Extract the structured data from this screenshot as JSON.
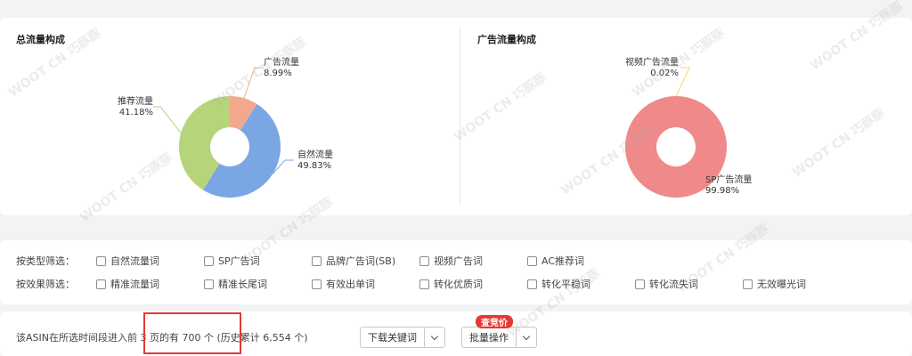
{
  "charts": {
    "total": {
      "title": "总流量构成",
      "chart_data": {
        "type": "pie",
        "title": "总流量构成",
        "donut": true,
        "slices": [
          {
            "name": "广告流量",
            "value": 8.99,
            "label": "8.99%",
            "color": "#f0a98c"
          },
          {
            "name": "自然流量",
            "value": 49.83,
            "label": "49.83%",
            "color": "#7aa7e3"
          },
          {
            "name": "推荐流量",
            "value": 41.18,
            "label": "41.18%",
            "color": "#b6d47a"
          }
        ]
      }
    },
    "ads": {
      "title": "广告流量构成",
      "chart_data": {
        "type": "pie",
        "title": "广告流量构成",
        "donut": true,
        "slices": [
          {
            "name": "视频广告流量",
            "value": 0.02,
            "label": "0.02%",
            "color": "#f5d76e"
          },
          {
            "name": "SP广告流量",
            "value": 99.98,
            "label": "99.98%",
            "color": "#f08a8a"
          }
        ]
      }
    }
  },
  "filters": {
    "type_label": "按类型筛选：",
    "type_options": [
      "自然流量词",
      "SP广告词",
      "品牌广告词(SB)",
      "视频广告词",
      "AC推荐词"
    ],
    "effect_label": "按效果筛选：",
    "effect_options": [
      "精准流量词",
      "精准长尾词",
      "有效出单词",
      "转化优质词",
      "转化平稳词",
      "转化流失词",
      "无效曝光词"
    ]
  },
  "summary": {
    "text": "该ASIN在所选时间段进入前 3 页的有 700 个 (历史累计 6,554 个)",
    "download_label": "下载关键词",
    "batch_label": "批量操作",
    "badge": "查竞价"
  },
  "watermark": "WOOT CN 巧豚豚"
}
